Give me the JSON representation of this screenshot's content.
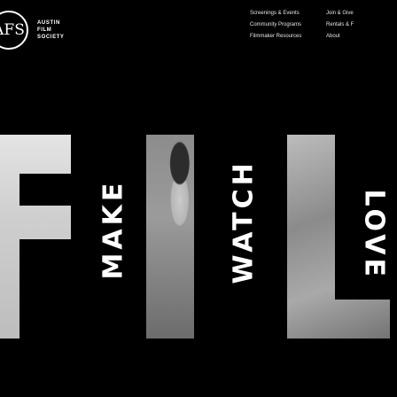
{
  "logo": {
    "mark": "AFS",
    "line1": "AUSTIN",
    "line2": "FILM",
    "line3": "SOCIETY"
  },
  "nav": [
    "Screenings & Events",
    "Join & Give",
    "Community Programs",
    "Rentals & F",
    "Filmmaker Resources",
    "About"
  ],
  "hero": {
    "words": [
      "MAKE",
      "WATCH",
      "LOVE"
    ],
    "letters": [
      "F",
      "I",
      "L"
    ]
  }
}
